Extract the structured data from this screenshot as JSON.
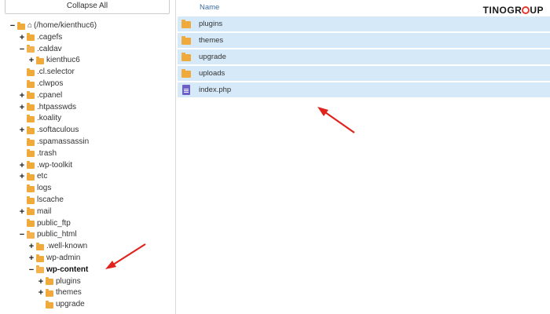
{
  "sidebar": {
    "collapse_label": "Collapse All",
    "tree": [
      {
        "label": "(/home/kienthuc6)",
        "toggle": "−",
        "kind": "home"
      },
      {
        "label": ".cagefs",
        "toggle": "+"
      },
      {
        "label": ".caldav",
        "toggle": "−",
        "open": true
      },
      {
        "label": "kienthuc6",
        "toggle": "+"
      },
      {
        "label": ".cl.selector",
        "toggle": ""
      },
      {
        "label": ".clwpos",
        "toggle": ""
      },
      {
        "label": ".cpanel",
        "toggle": "+"
      },
      {
        "label": ".htpasswds",
        "toggle": "+"
      },
      {
        "label": ".koality",
        "toggle": ""
      },
      {
        "label": ".softaculous",
        "toggle": "+"
      },
      {
        "label": ".spamassassin",
        "toggle": ""
      },
      {
        "label": ".trash",
        "toggle": ""
      },
      {
        "label": ".wp-toolkit",
        "toggle": "+"
      },
      {
        "label": "etc",
        "toggle": "+"
      },
      {
        "label": "logs",
        "toggle": ""
      },
      {
        "label": "lscache",
        "toggle": ""
      },
      {
        "label": "mail",
        "toggle": "+"
      },
      {
        "label": "public_ftp",
        "toggle": ""
      },
      {
        "label": "public_html",
        "toggle": "−",
        "open": true
      },
      {
        "label": ".well-known",
        "toggle": "+"
      },
      {
        "label": "wp-admin",
        "toggle": "+"
      },
      {
        "label": "wp-content",
        "toggle": "−",
        "open": true,
        "bold": true
      },
      {
        "label": "plugins",
        "toggle": "+"
      },
      {
        "label": "themes",
        "toggle": "+"
      },
      {
        "label": "upgrade",
        "toggle": ""
      }
    ]
  },
  "main": {
    "column_name": "Name",
    "logo_text_1": "TINO",
    "logo_text_2": "GR",
    "logo_text_3": "UP",
    "files": [
      {
        "name": "plugins",
        "type": "folder"
      },
      {
        "name": "themes",
        "type": "folder"
      },
      {
        "name": "upgrade",
        "type": "folder"
      },
      {
        "name": "uploads",
        "type": "folder"
      },
      {
        "name": "index.php",
        "type": "php"
      }
    ]
  },
  "colors": {
    "accent_arrow": "#e0231c",
    "row_selected": "#d6e9f8",
    "folder": "#f0a93b",
    "php_icon": "#6c5fc7",
    "header_link": "#3a6ea5"
  }
}
